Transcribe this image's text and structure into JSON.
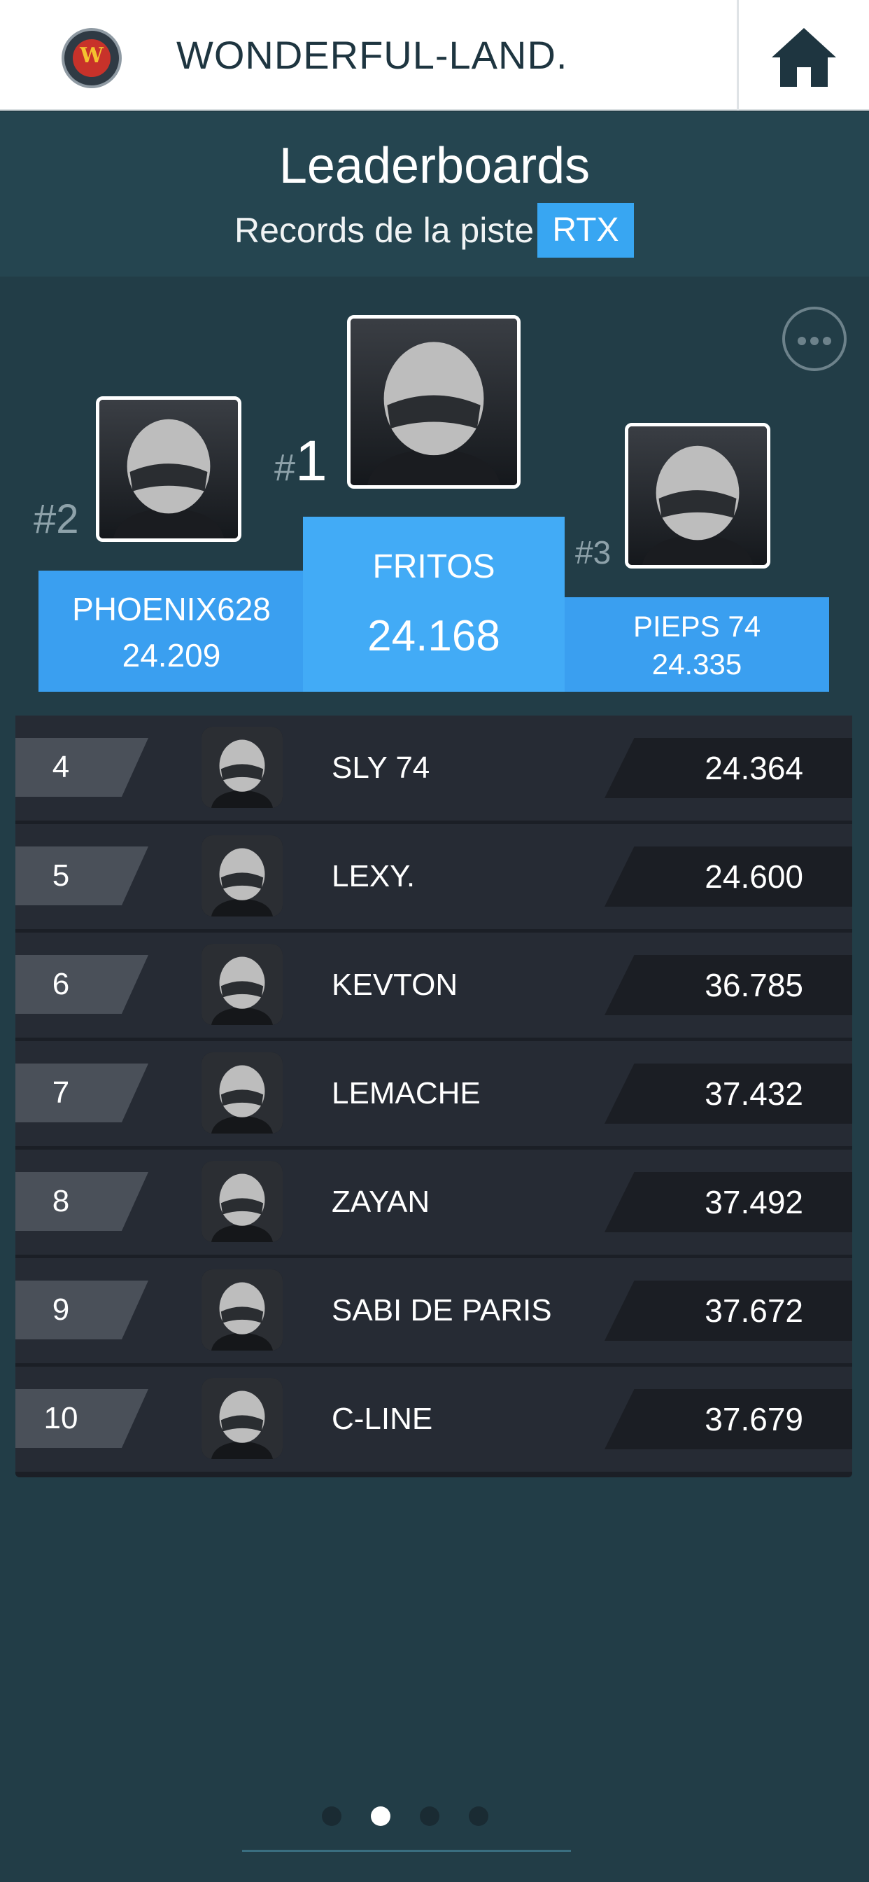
{
  "app": {
    "brand": "WONDERFUL-LAND.",
    "logo_text": "W"
  },
  "header": {
    "title": "Leaderboards",
    "subtitle": "Records de la piste",
    "track_badge": "RTX"
  },
  "podium": [
    {
      "rank_prefix": "#",
      "rank": "1",
      "name": "FRITOS",
      "time": "24.168"
    },
    {
      "rank_prefix": "#",
      "rank": "2",
      "name": "PHOENIX628",
      "time": "24.209"
    },
    {
      "rank_prefix": "#",
      "rank": "3",
      "name": "PIEPS 74",
      "time": "24.335"
    }
  ],
  "rows": [
    {
      "rank": "4",
      "name": "SLY 74",
      "time": "24.364"
    },
    {
      "rank": "5",
      "name": "LEXY.",
      "time": "24.600"
    },
    {
      "rank": "6",
      "name": "KEVTON",
      "time": "36.785"
    },
    {
      "rank": "7",
      "name": "LEMACHE",
      "time": "37.432"
    },
    {
      "rank": "8",
      "name": "ZAYAN",
      "time": "37.492"
    },
    {
      "rank": "9",
      "name": "SABI DE PARIS",
      "time": "37.672"
    },
    {
      "rank": "10",
      "name": "C-LINE",
      "time": "37.679"
    }
  ],
  "pager": {
    "pages": 4,
    "active_page": 2
  },
  "icons": {
    "home": "home-icon",
    "more": "more-options-icon",
    "avatar": "helmet-avatar-icon"
  },
  "colors": {
    "background": "#223d47",
    "accent_blue": "#3aa3f0",
    "row_bg": "#262b34"
  }
}
